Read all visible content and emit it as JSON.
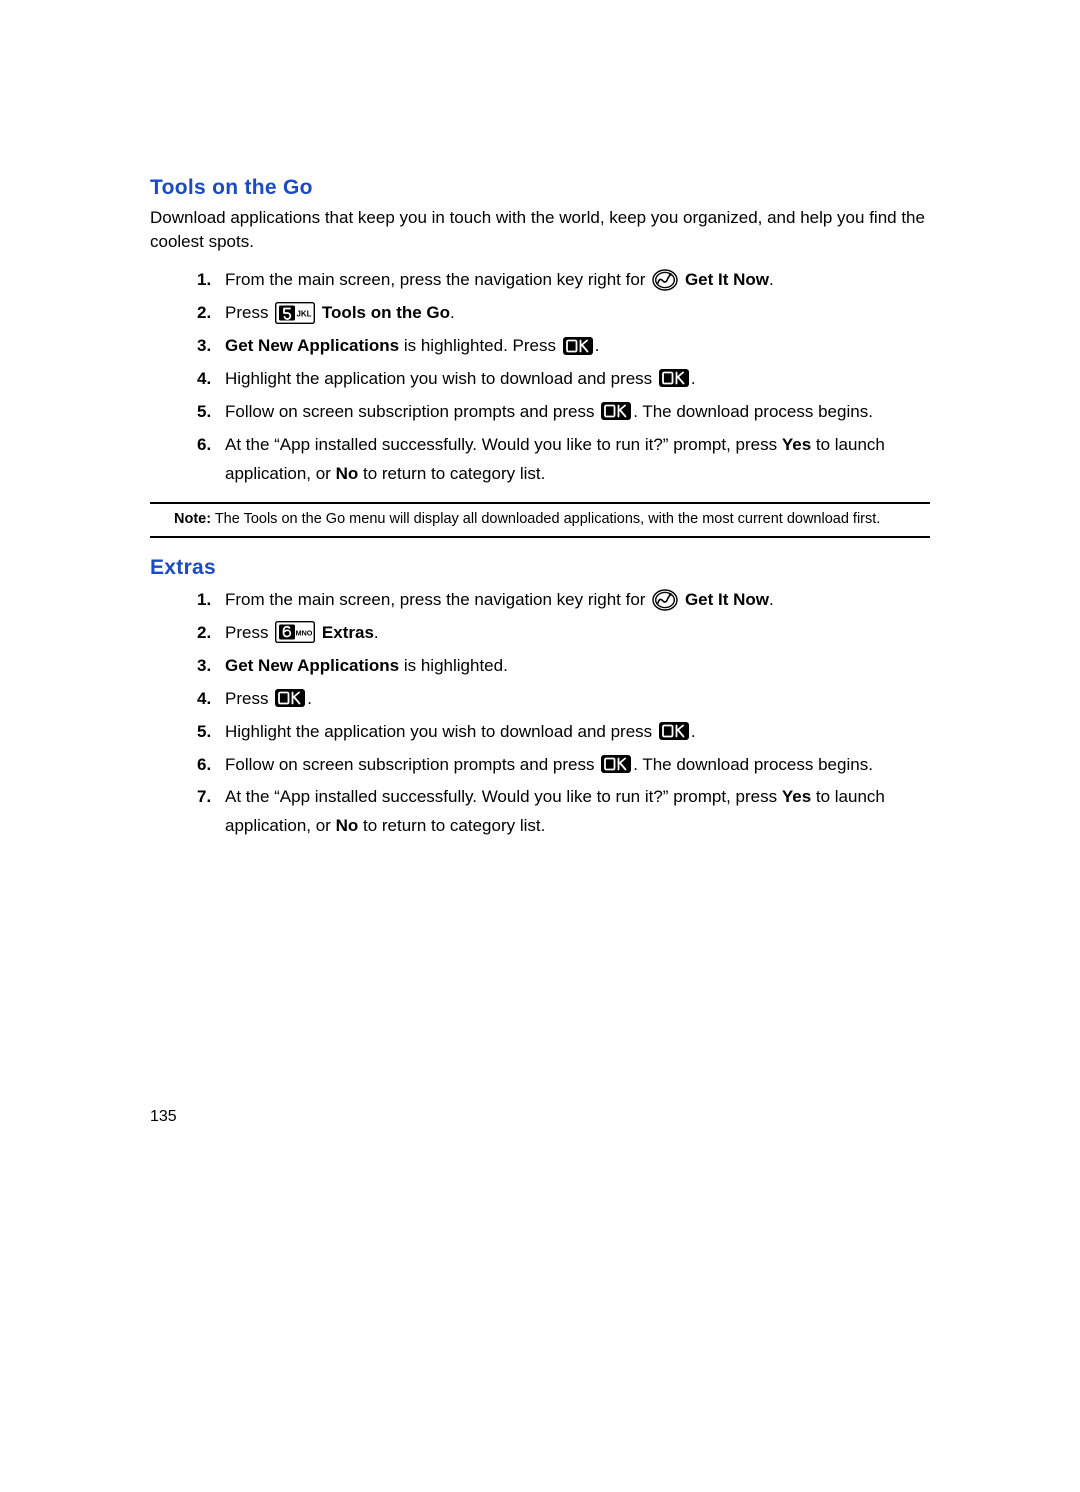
{
  "sections": {
    "tools": {
      "heading": "Tools on the Go",
      "intro": "Download applications that keep you in touch with the world, keep you organized, and help you find the coolest spots.",
      "steps": {
        "s1_a": "From the main screen, press the navigation key right for ",
        "s1_b": "Get It Now",
        "s1_c": ".",
        "s2_a": "Press ",
        "s2_b": "Tools on the Go",
        "s2_c": ".",
        "s3_a": "Get New Applications",
        "s3_b": " is highlighted. Press ",
        "s3_c": ".",
        "s4_a": "Highlight the application you wish to download and press ",
        "s4_b": ".",
        "s5_a": "Follow on screen subscription prompts and press ",
        "s5_b": ". The download process begins.",
        "s6_a": "At the “App installed successfully. Would you like to run it?” prompt, press ",
        "s6_yes": "Yes",
        "s6_b": " to launch application, or ",
        "s6_no": "No",
        "s6_c": " to return to category list."
      },
      "note_label": "Note:",
      "note_text": " The Tools on the Go menu will display all downloaded applications, with the most current download first."
    },
    "extras": {
      "heading": "Extras",
      "steps": {
        "s1_a": "From the main screen, press the navigation key right for ",
        "s1_b": "Get It Now",
        "s1_c": ".",
        "s2_a": "Press ",
        "s2_b": "Extras",
        "s2_c": ".",
        "s3_a": "Get New Applications",
        "s3_b": " is highlighted.",
        "s4_a": "Press ",
        "s4_b": ".",
        "s5_a": "Highlight the application you wish to download and press ",
        "s5_b": ".",
        "s6_a": "Follow on screen subscription prompts and press ",
        "s6_b": ". The download process begins.",
        "s7_a": "At the “App installed successfully. Would you like to run it?” prompt, press ",
        "s7_yes": "Yes",
        "s7_b": " to launch application, or ",
        "s7_no": "No",
        "s7_c": " to return to category list."
      }
    }
  },
  "page_number": "135",
  "icon_labels": {
    "getitnow": "get-it-now-icon",
    "key5": "key-5jkl-icon",
    "key6": "key-6mno-icon",
    "ok": "ok-key-icon"
  }
}
